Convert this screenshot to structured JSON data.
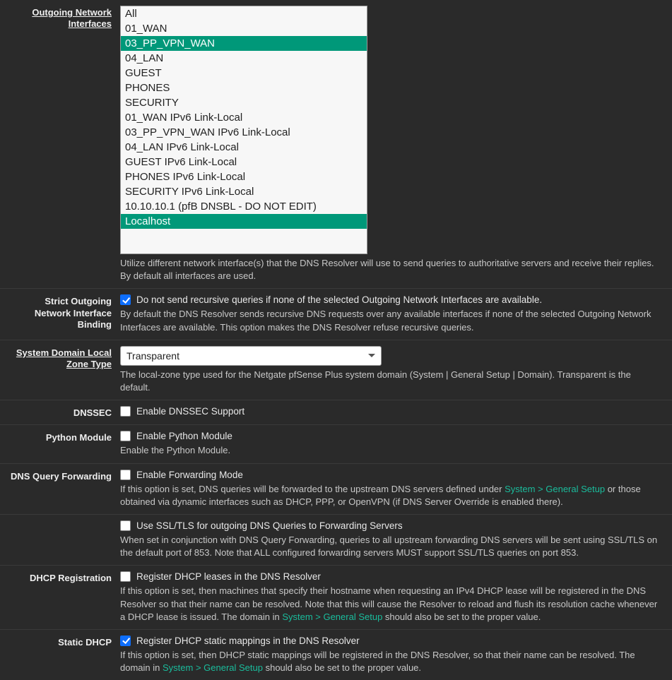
{
  "rows": {
    "outgoing_interfaces": {
      "label": "Outgoing Network Interfaces",
      "help": "Utilize different network interface(s) that the DNS Resolver will use to send queries to authoritative servers and receive their replies. By default all interfaces are used."
    },
    "strict_outgoing": {
      "label": "Strict Outgoing Network Interface Binding",
      "checkbox_label": "Do not send recursive queries if none of the selected Outgoing Network Interfaces are available.",
      "help": "By default the DNS Resolver sends recursive DNS requests over any available interfaces if none of the selected Outgoing Network Interfaces are available. This option makes the DNS Resolver refuse recursive queries."
    },
    "zone_type": {
      "label": "System Domain Local Zone Type",
      "value": "Transparent",
      "help": "The local-zone type used for the Netgate pfSense Plus system domain (System | General Setup | Domain). Transparent is the default."
    },
    "dnssec": {
      "label": "DNSSEC",
      "checkbox_label": "Enable DNSSEC Support"
    },
    "python": {
      "label": "Python Module",
      "checkbox_label": "Enable Python Module",
      "help": "Enable the Python Module."
    },
    "forwarding": {
      "label": "DNS Query Forwarding",
      "checkbox_label": "Enable Forwarding Mode",
      "help_pre": "If this option is set, DNS queries will be forwarded to the upstream DNS servers defined under ",
      "link": "System > General Setup",
      "help_post": " or those obtained via dynamic interfaces such as DHCP, PPP, or OpenVPN (if DNS Server Override is enabled there)."
    },
    "ssltls": {
      "checkbox_label": "Use SSL/TLS for outgoing DNS Queries to Forwarding Servers",
      "help": "When set in conjunction with DNS Query Forwarding, queries to all upstream forwarding DNS servers will be sent using SSL/TLS on the default port of 853. Note that ALL configured forwarding servers MUST support SSL/TLS queries on port 853."
    },
    "dhcp_reg": {
      "label": "DHCP Registration",
      "checkbox_label": "Register DHCP leases in the DNS Resolver",
      "help_pre": "If this option is set, then machines that specify their hostname when requesting an IPv4 DHCP lease will be registered in the DNS Resolver so that their name can be resolved. Note that this will cause the Resolver to reload and flush its resolution cache whenever a DHCP lease is issued. The domain in ",
      "link": "System > General Setup",
      "help_post": " should also be set to the proper value."
    },
    "static_dhcp": {
      "label": "Static DHCP",
      "checkbox_label": "Register DHCP static mappings in the DNS Resolver",
      "help_pre": "If this option is set, then DHCP static mappings will be registered in the DNS Resolver, so that their name can be resolved. The domain in ",
      "link": "System > General Setup",
      "help_post": " should also be set to the proper value."
    }
  },
  "interfaces": [
    {
      "name": "All",
      "selected": false
    },
    {
      "name": "01_WAN",
      "selected": false
    },
    {
      "name": "03_PP_VPN_WAN",
      "selected": true
    },
    {
      "name": "04_LAN",
      "selected": false
    },
    {
      "name": "GUEST",
      "selected": false
    },
    {
      "name": "PHONES",
      "selected": false
    },
    {
      "name": "SECURITY",
      "selected": false
    },
    {
      "name": "01_WAN IPv6 Link-Local",
      "selected": false
    },
    {
      "name": "03_PP_VPN_WAN IPv6 Link-Local",
      "selected": false
    },
    {
      "name": "04_LAN IPv6 Link-Local",
      "selected": false
    },
    {
      "name": "GUEST IPv6 Link-Local",
      "selected": false
    },
    {
      "name": "PHONES IPv6 Link-Local",
      "selected": false
    },
    {
      "name": "SECURITY IPv6 Link-Local",
      "selected": false
    },
    {
      "name": "10.10.10.1 (pfB DNSBL - DO NOT EDIT)",
      "selected": false
    },
    {
      "name": "Localhost",
      "selected": true
    }
  ]
}
